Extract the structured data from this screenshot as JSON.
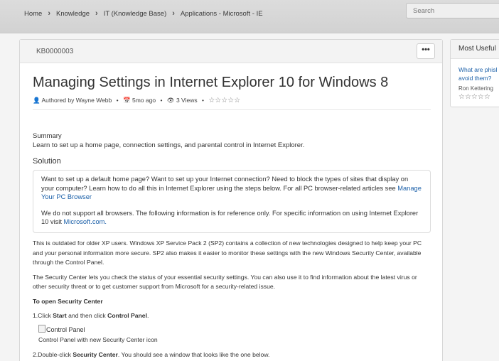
{
  "breadcrumb": {
    "items": [
      "Home",
      "Knowledge",
      "IT (Knowledge Base)",
      "Applications - Microsoft - IE"
    ]
  },
  "search": {
    "placeholder": "Search"
  },
  "article": {
    "number": "KB0000003",
    "more_button": "•••",
    "title": "Managing Settings in Internet Explorer 10 for Windows 8",
    "meta": {
      "author": "Authored by Wayne Webb",
      "age": "5mo ago",
      "views": "3 Views",
      "rating_stars": "☆☆☆☆☆"
    },
    "summary_label": "Summary",
    "summary_text": "Learn to set up a home page, connection settings, and parental control in Internet Explorer.",
    "solution_label": "Solution",
    "solution": {
      "p1": "Want to set up a default home page? Want to set up your Internet connection? Need to block the types of sites that display on your computer? Learn how to do all this in Internet Explorer using the steps below. For all PC browser-related articles see",
      "p1_link": "Manage Your PC Browser",
      "p2": "We do not support all browsers. The following information is for reference only. For specific information on using Internet Explorer 10 visit",
      "p2_link": "Microsoft.com."
    },
    "body": {
      "para1": "This is outdated for older XP users. Windows XP Service Pack 2 (SP2) contains a collection of new technologies designed to help keep your PC and your personal information more secure. SP2 also makes it easier to monitor these settings with the new Windows Security Center, available through the Control Panel.",
      "para2": "The Security Center lets you check the status of your essential security settings. You can also use it to find information about the latest virus or other security threat or to get customer support from Microsoft for a security-related issue.",
      "heading": "To open Security Center",
      "step1_prefix": "1.Click ",
      "step1_start": "Start",
      "step1_mid": " and then click ",
      "step1_cp": "Control Panel",
      "step1_end": ".",
      "image_alt": "Control Panel",
      "image_caption": "Control Panel with new Security Center icon",
      "step2_prefix": "2.Double-click ",
      "step2_bold": "Security Center",
      "step2_end": ". You should see a window that looks like the one below."
    }
  },
  "sidebar": {
    "title": "Most Useful",
    "item_title_line1": "What are phisl",
    "item_title_line2": "avoid them?",
    "item_author": "Ron Kettering",
    "item_stars": "☆☆☆☆☆"
  }
}
